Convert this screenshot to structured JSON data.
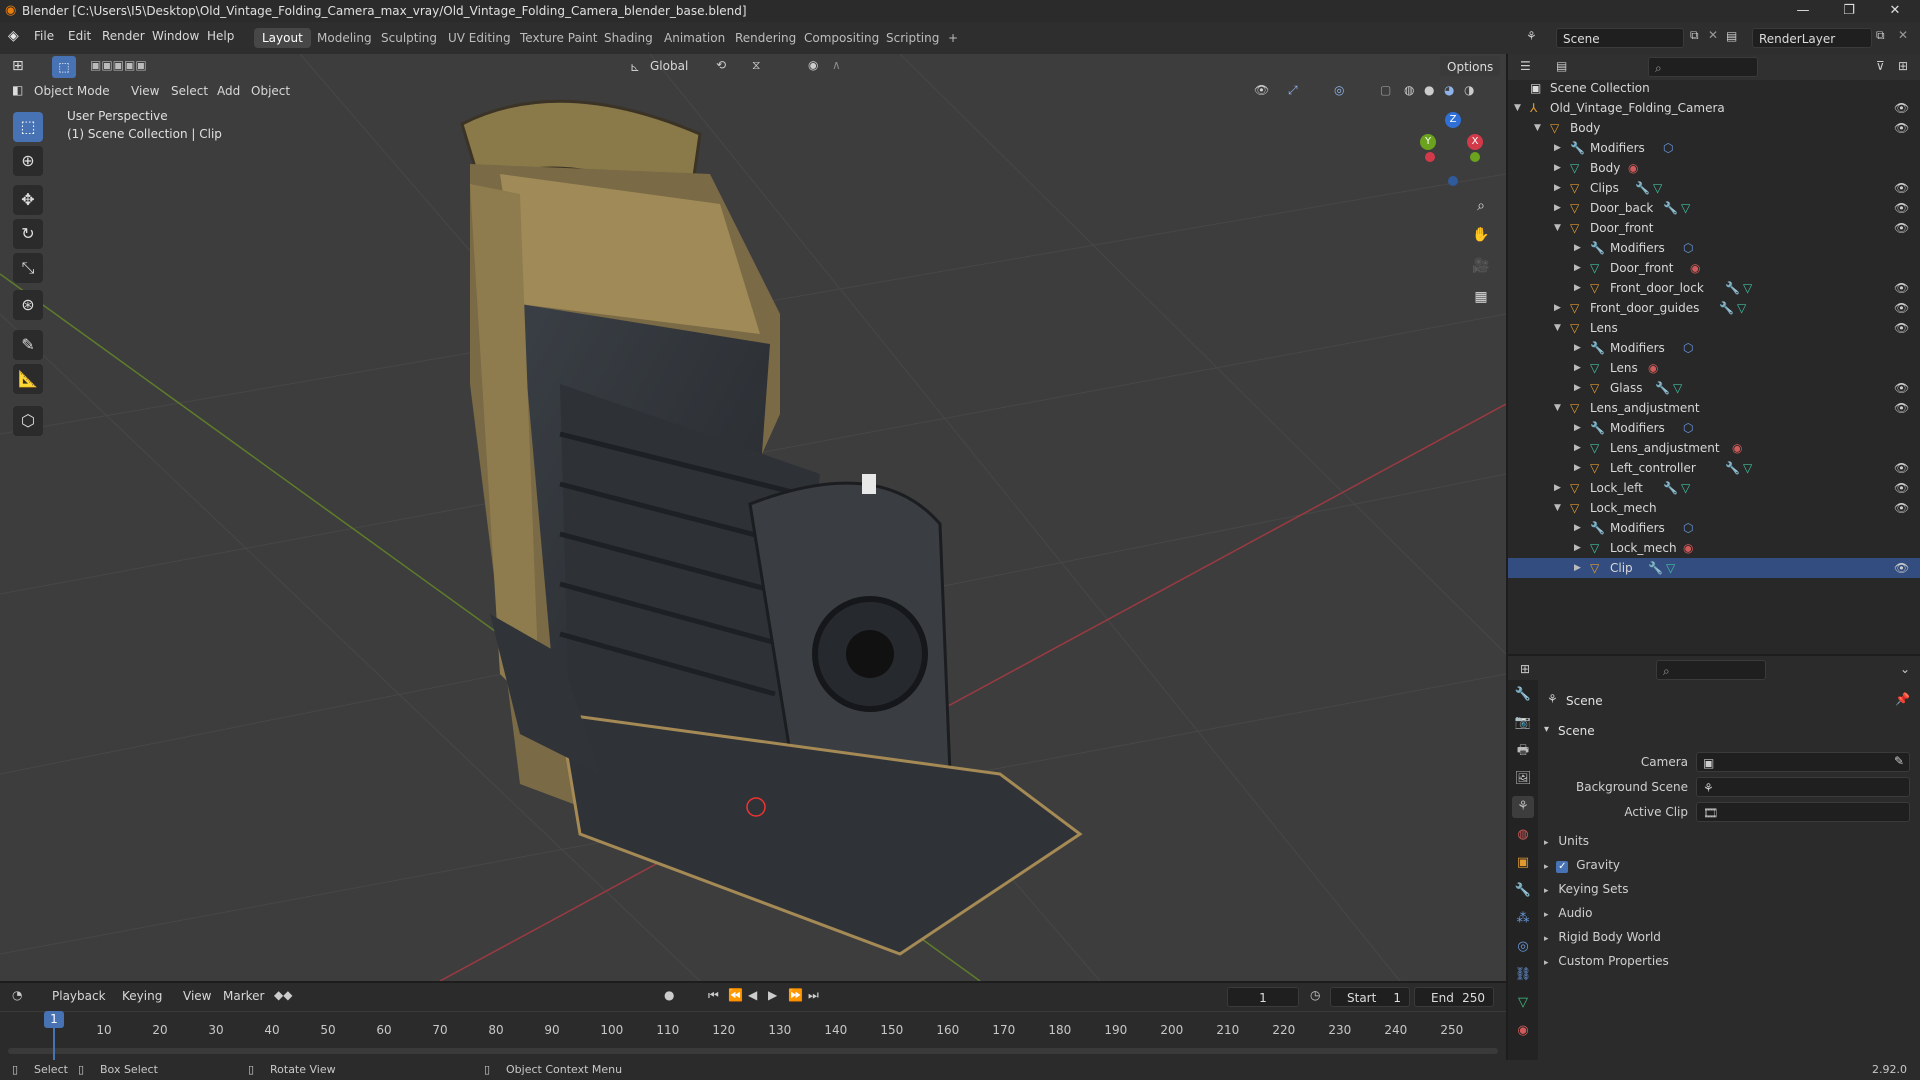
{
  "window": {
    "title": "Blender [C:\\Users\\I5\\Desktop\\Old_Vintage_Folding_Camera_max_vray/Old_Vintage_Folding_Camera_blender_base.blend]",
    "minimize": "—",
    "maximize": "❐",
    "close": "✕"
  },
  "menubar": {
    "items": [
      "File",
      "Edit",
      "Render",
      "Window",
      "Help"
    ],
    "workspaces": [
      "Layout",
      "Modeling",
      "Sculpting",
      "UV Editing",
      "Texture Paint",
      "Shading",
      "Animation",
      "Rendering",
      "Compositing",
      "Scripting"
    ],
    "active_workspace": "Layout",
    "add_tab": "+",
    "scene_label": "Scene",
    "render_layer": "RenderLayer"
  },
  "viewport": {
    "mode": "Object Mode",
    "menus": [
      "View",
      "Select",
      "Add",
      "Object"
    ],
    "transform_orientation": "Global",
    "options": "Options",
    "overlay_line1": "User Perspective",
    "overlay_line2": "(1) Scene Collection | Clip",
    "gizmo": {
      "x": "X",
      "y": "Y",
      "z": "Z"
    },
    "colors": {
      "bg": "#3d3d3d",
      "grid": "#4a4a4a",
      "x_axis": "#b33f48",
      "y_axis": "#6b9b2a",
      "accent": "#4772b3"
    }
  },
  "outliner": {
    "root": "Scene Collection",
    "search_placeholder": "",
    "rows": [
      {
        "label": "Old_Vintage_Folding_Camera",
        "depth": 0,
        "expanded": true,
        "icon": "empty",
        "eye": true
      },
      {
        "label": "Body",
        "depth": 1,
        "expanded": true,
        "icon": "object",
        "eye": true
      },
      {
        "label": "Modifiers",
        "depth": 2,
        "expanded": false,
        "icon": "wrench",
        "eye": false,
        "extra": [
          "modifier"
        ]
      },
      {
        "label": "Body",
        "depth": 2,
        "expanded": false,
        "icon": "mesh",
        "eye": false,
        "extra": [
          "material"
        ]
      },
      {
        "label": "Clips",
        "depth": 2,
        "expanded": false,
        "icon": "object",
        "eye": true,
        "extra": [
          "wrench",
          "mesh"
        ]
      },
      {
        "label": "Door_back",
        "depth": 2,
        "expanded": false,
        "icon": "object",
        "eye": true,
        "extra": [
          "wrench",
          "mesh"
        ]
      },
      {
        "label": "Door_front",
        "depth": 2,
        "expanded": true,
        "icon": "object",
        "eye": true
      },
      {
        "label": "Modifiers",
        "depth": 3,
        "expanded": false,
        "icon": "wrench",
        "eye": false,
        "extra": [
          "modifier"
        ]
      },
      {
        "label": "Door_front",
        "depth": 3,
        "expanded": false,
        "icon": "mesh",
        "eye": false,
        "extra": [
          "material"
        ]
      },
      {
        "label": "Front_door_lock",
        "depth": 3,
        "expanded": false,
        "icon": "object",
        "eye": true,
        "extra": [
          "wrench",
          "mesh"
        ]
      },
      {
        "label": "Front_door_guides",
        "depth": 2,
        "expanded": false,
        "icon": "object",
        "eye": true,
        "extra": [
          "wrench",
          "mesh"
        ]
      },
      {
        "label": "Lens",
        "depth": 2,
        "expanded": true,
        "icon": "object",
        "eye": true
      },
      {
        "label": "Modifiers",
        "depth": 3,
        "expanded": false,
        "icon": "wrench",
        "eye": false,
        "extra": [
          "modifier"
        ]
      },
      {
        "label": "Lens",
        "depth": 3,
        "expanded": false,
        "icon": "mesh",
        "eye": false,
        "extra": [
          "material"
        ]
      },
      {
        "label": "Glass",
        "depth": 3,
        "expanded": false,
        "icon": "object",
        "eye": true,
        "extra": [
          "wrench",
          "mesh"
        ]
      },
      {
        "label": "Lens_andjustment",
        "depth": 2,
        "expanded": true,
        "icon": "object",
        "eye": true
      },
      {
        "label": "Modifiers",
        "depth": 3,
        "expanded": false,
        "icon": "wrench",
        "eye": false,
        "extra": [
          "modifier"
        ]
      },
      {
        "label": "Lens_andjustment",
        "depth": 3,
        "expanded": false,
        "icon": "mesh",
        "eye": false,
        "extra": [
          "material"
        ]
      },
      {
        "label": "Left_controller",
        "depth": 3,
        "expanded": false,
        "icon": "object",
        "eye": true,
        "extra": [
          "wrench",
          "mesh"
        ]
      },
      {
        "label": "Lock_left",
        "depth": 2,
        "expanded": false,
        "icon": "object",
        "eye": true,
        "extra": [
          "wrench",
          "mesh"
        ]
      },
      {
        "label": "Lock_mech",
        "depth": 2,
        "expanded": true,
        "icon": "object",
        "eye": true
      },
      {
        "label": "Modifiers",
        "depth": 3,
        "expanded": false,
        "icon": "wrench",
        "eye": false,
        "extra": [
          "modifier"
        ]
      },
      {
        "label": "Lock_mech",
        "depth": 3,
        "expanded": false,
        "icon": "mesh",
        "eye": false,
        "extra": [
          "material"
        ]
      },
      {
        "label": "Clip",
        "depth": 3,
        "expanded": false,
        "icon": "object",
        "eye": true,
        "extra": [
          "wrench",
          "mesh"
        ],
        "active": true
      }
    ]
  },
  "properties": {
    "breadcrumb": "Scene",
    "panel_title": "Scene",
    "camera_label": "Camera",
    "background_scene_label": "Background Scene",
    "active_clip_label": "Active Clip",
    "sections": [
      "Units",
      "Gravity",
      "Keying Sets",
      "Audio",
      "Rigid Body World",
      "Custom Properties"
    ],
    "gravity_checked": true
  },
  "timeline": {
    "menus": [
      "Playback",
      "Keying",
      "View",
      "Marker"
    ],
    "current_frame": "1",
    "start_label": "Start",
    "start_value": "1",
    "end_label": "End",
    "end_value": "250",
    "ticks": [
      "1",
      "10",
      "20",
      "30",
      "40",
      "50",
      "60",
      "70",
      "80",
      "90",
      "100",
      "110",
      "120",
      "130",
      "140",
      "150",
      "160",
      "170",
      "180",
      "190",
      "200",
      "210",
      "220",
      "230",
      "240",
      "250"
    ]
  },
  "statusbar": {
    "select": "Select",
    "box_select": "Box Select",
    "rotate_view": "Rotate View",
    "context_menu": "Object Context Menu",
    "version": "2.92.0"
  }
}
